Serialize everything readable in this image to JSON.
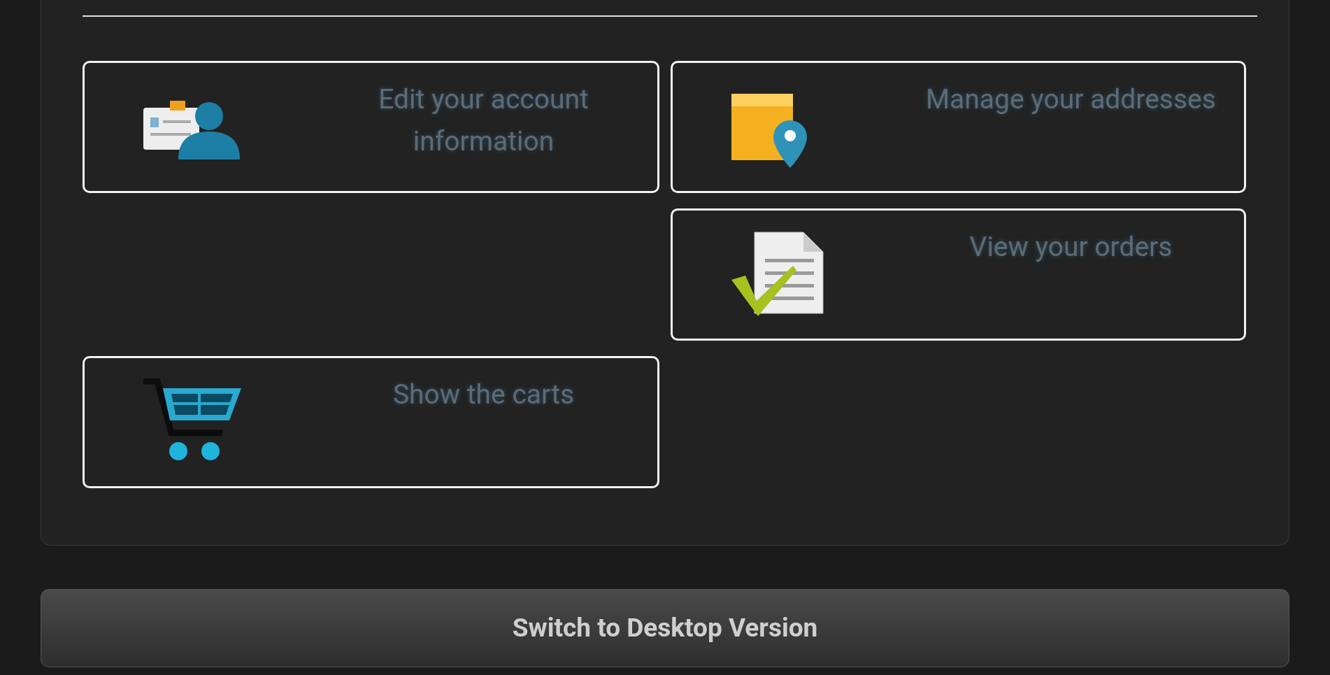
{
  "options": [
    {
      "label": "Edit your account information",
      "kind": "account"
    },
    {
      "label": "Manage your addresses",
      "kind": "address"
    },
    {
      "label": "View your orders",
      "kind": "orders"
    },
    {
      "label": "Show the carts",
      "kind": "cart"
    }
  ],
  "footer_button": {
    "label": "Switch to Desktop Version"
  }
}
